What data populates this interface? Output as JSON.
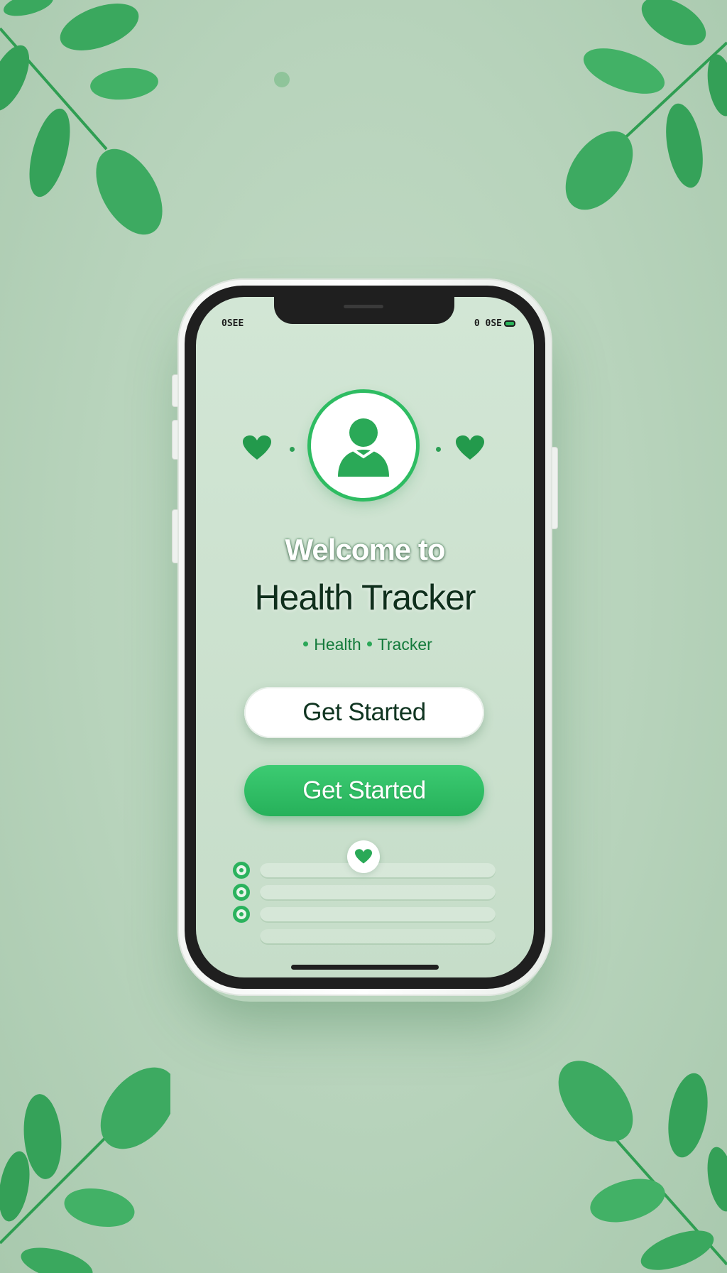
{
  "status_bar": {
    "left_text": "0SEE",
    "right_text": "0 0SE"
  },
  "hero": {
    "welcome": "Welcome to",
    "app_name": "Health Tracker",
    "tagline_left": "Health",
    "tagline_right": "Tracker"
  },
  "buttons": {
    "primary_white_label": "Get Started",
    "primary_green_label": "Get Started"
  },
  "colors": {
    "accent_green": "#2ebc62",
    "background": "#b7d3bb",
    "dark_text": "#0f2f1c"
  },
  "icons": {
    "avatar": "user-avatar-icon",
    "heart": "heart-icon",
    "badge": "heart-badge-icon",
    "leaf": "leaf-branch-icon",
    "battery": "battery-icon"
  }
}
